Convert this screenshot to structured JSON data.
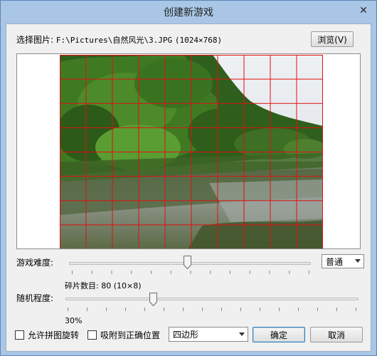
{
  "window": {
    "title": "创建新游戏",
    "close_glyph": "✕"
  },
  "picture": {
    "label": "选择图片:",
    "path": "F:\\Pictures\\自然风光\\3.JPG",
    "dimensions": "(1024×768)",
    "browse_label": "浏览(V)",
    "grid_columns": 10,
    "grid_rows": 8,
    "grid_color": "#e01010"
  },
  "difficulty": {
    "label": "游戏难度:",
    "level": 0.49,
    "selected": "普通",
    "pieces_label": "碎片数目: 80 (10×8)"
  },
  "randomness": {
    "label": "随机程度:",
    "level": 0.3,
    "value_text": "30%"
  },
  "options": {
    "allow_rotate": "允许拼图旋转",
    "snap_to_position": "吸附到正确位置",
    "shape_selected": "四边形"
  },
  "actions": {
    "ok": "确定",
    "cancel": "取消"
  },
  "colors": {
    "title_bg": "#a9c6e6",
    "dialog_bg": "#f0f0f0",
    "grid": "#e01010"
  }
}
